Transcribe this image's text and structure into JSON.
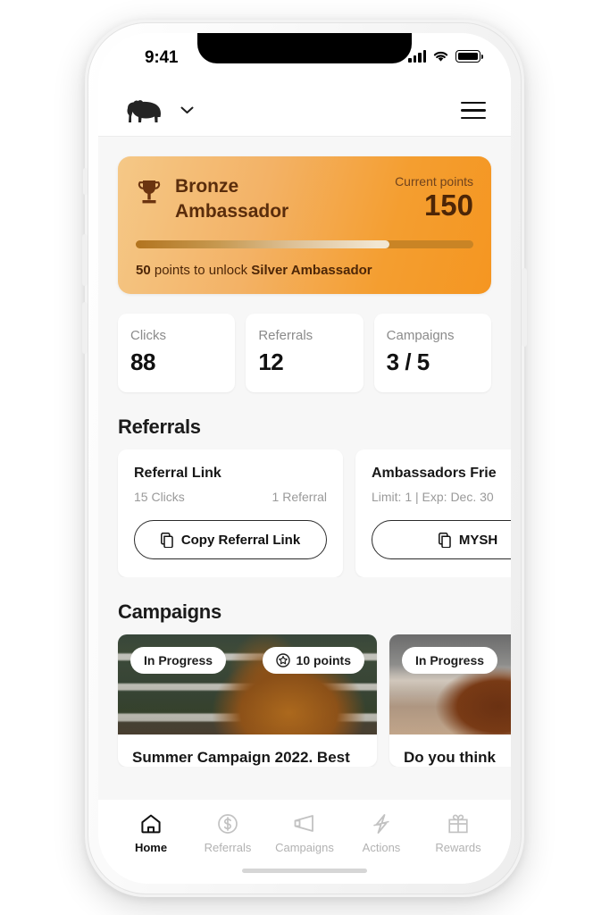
{
  "device": {
    "status_bar": {
      "time": "9:41",
      "icons": [
        "cellular-signal-icon",
        "wifi-icon",
        "battery-icon"
      ]
    }
  },
  "header": {
    "logo_name": "bear-logo",
    "dropdown_icon": "chevron-down-icon",
    "menu_icon": "hamburger-menu-icon"
  },
  "tier_card": {
    "icon": "trophy-icon",
    "tier_name": "Bronze\nAmbassador",
    "tier_name_line1": "Bronze",
    "tier_name_line2": "Ambassador",
    "points_label": "Current points",
    "points_value": "150",
    "progress_percent": 75,
    "note_prefix": "50",
    "note_middle": " points to unlock ",
    "note_target": "Silver Ambassador",
    "colors": {
      "gradient_start": "#f5c887",
      "gradient_end": "#f59621",
      "text": "#4d2607"
    }
  },
  "stats": [
    {
      "label": "Clicks",
      "value": "88"
    },
    {
      "label": "Referrals",
      "value": "12"
    },
    {
      "label": "Campaigns",
      "value": "3 / 5"
    }
  ],
  "referrals_section": {
    "title": "Referrals",
    "cards": [
      {
        "title": "Referral Link",
        "meta_left": "15 Clicks",
        "meta_right": "1 Referral",
        "button_label": "Copy Referral Link",
        "button_icon": "copy-icon"
      },
      {
        "title": "Ambassadors Frie",
        "meta_left": "Limit: 1 | Exp: Dec. 30",
        "meta_right": "",
        "button_label": "MYSH",
        "button_icon": "copy-icon"
      }
    ]
  },
  "campaigns_section": {
    "title": "Campaigns",
    "cards": [
      {
        "status_badge": "In Progress",
        "points_badge": "10 points",
        "points_icon": "star-badge-icon",
        "title": "Summer Campaign 2022. Best",
        "image_name": "horse-in-stable-photo"
      },
      {
        "status_badge": "In Progress",
        "points_badge": "",
        "points_icon": "",
        "title": "Do you think",
        "image_name": "horses-outdoors-photo"
      }
    ]
  },
  "accent_bar": {
    "color": "#f4246c"
  },
  "tab_bar": {
    "active": "Home",
    "items": [
      {
        "label": "Home",
        "icon": "home-icon"
      },
      {
        "label": "Referrals",
        "icon": "dollar-circle-icon"
      },
      {
        "label": "Campaigns",
        "icon": "megaphone-icon"
      },
      {
        "label": "Actions",
        "icon": "lightning-bolt-icon"
      },
      {
        "label": "Rewards",
        "icon": "gift-icon"
      }
    ]
  }
}
